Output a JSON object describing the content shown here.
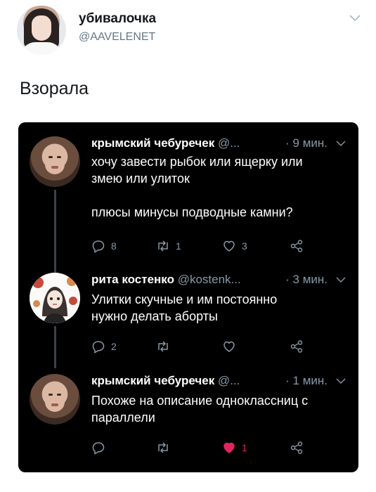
{
  "outer": {
    "display_name": "убивалочка",
    "handle": "@AAVELENET",
    "text": "Взорала"
  },
  "tweets": [
    {
      "name": "крымский чебуречек",
      "handle": "@...",
      "time": "· 9 мин.",
      "body_lines": [
        "хочу завести рыбок или ящерку или",
        "змею или улиток",
        "",
        "плюсы минусы подводные камни?"
      ],
      "replies": "8",
      "retweets": "1",
      "likes": "3",
      "liked": false
    },
    {
      "name": "рита костенко",
      "handle": "@kostenk...",
      "time": "· 3 мин.",
      "body_lines": [
        "Улитки скучные и им постоянно",
        "нужно делать аборты"
      ],
      "replies": "2",
      "retweets": "",
      "likes": "",
      "liked": false
    },
    {
      "name": "крымский чебуречек",
      "handle": "@...",
      "time": "· 1 мин.",
      "body_lines": [
        "Похоже на описание одноклассниц с",
        "параллели"
      ],
      "replies": "",
      "retweets": "",
      "likes": "1",
      "liked": true
    }
  ],
  "colors": {
    "card_bg": "#000000",
    "secondary": "#8899a6",
    "like": "#e0245e"
  },
  "icons": [
    "reply-icon",
    "retweet-icon",
    "like-icon",
    "share-icon",
    "chevron-down-icon"
  ]
}
